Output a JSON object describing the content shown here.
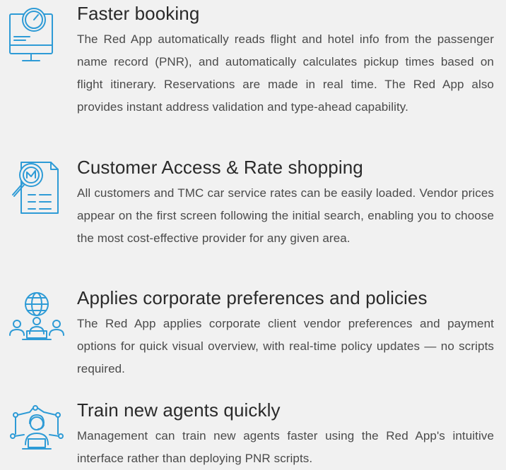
{
  "features": [
    {
      "title": "Faster booking",
      "description": "The Red App automatically reads flight and hotel info from the passenger name record (PNR), and automatically calculates pickup times based on flight itinerary. Reservations are made in real time. The Red App also provides instant address validation and type-ahead capability.",
      "icon": "monitor-gauge-icon"
    },
    {
      "title": "Customer Access & Rate shopping",
      "description": "All customers and TMC car service rates can be easily loaded. Vendor prices appear on the first screen following the initial search, enabling you to choose the most cost-effective provider for any given area.",
      "icon": "document-magnifier-icon"
    },
    {
      "title": "Applies corporate preferences and policies",
      "description": "The Red App applies corporate client vendor preferences and payment options for quick visual overview, with real-time policy updates — no scripts required.",
      "icon": "globe-people-icon"
    },
    {
      "title": "Train new agents quickly",
      "description": "Management can train new agents faster using the Red App's intuitive interface rather than deploying PNR scripts.",
      "icon": "agent-network-icon"
    }
  ],
  "colors": {
    "background": "#f1f1f1",
    "icon_blue": "#2e9bd6",
    "title": "#2a2a2a",
    "body_text": "#4a4a4a"
  }
}
